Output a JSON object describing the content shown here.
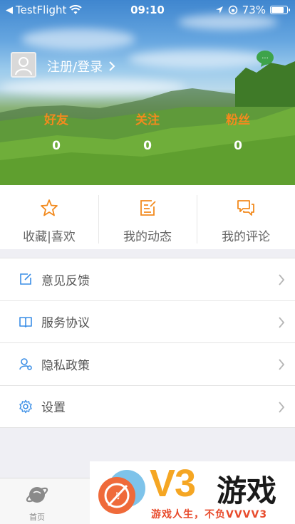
{
  "status_bar": {
    "carrier": "TestFlight",
    "time": "09:10",
    "battery": "73%",
    "battery_level": 0.73
  },
  "profile": {
    "login_text": "注册/登录"
  },
  "stats": [
    {
      "label": "好友",
      "value": "0"
    },
    {
      "label": "关注",
      "value": "0"
    },
    {
      "label": "粉丝",
      "value": "0"
    }
  ],
  "quick_actions": [
    {
      "label": "收藏|喜欢",
      "icon": "star-icon"
    },
    {
      "label": "我的动态",
      "icon": "edit-note-icon"
    },
    {
      "label": "我的评论",
      "icon": "comments-icon"
    }
  ],
  "menu": [
    {
      "label": "意见反馈",
      "icon": "feedback-icon"
    },
    {
      "label": "服务协议",
      "icon": "book-icon"
    },
    {
      "label": "隐私政策",
      "icon": "user-shield-icon"
    },
    {
      "label": "设置",
      "icon": "gear-icon"
    }
  ],
  "tabbar": {
    "home_label": "首页"
  },
  "ad": {
    "brand": "V3",
    "name": "游戏",
    "slogan": "游戏人生，不负VVVV3"
  },
  "colors": {
    "accent_orange": "#f28a1e",
    "icon_blue": "#3a8ee6",
    "text_gray": "#666666"
  }
}
